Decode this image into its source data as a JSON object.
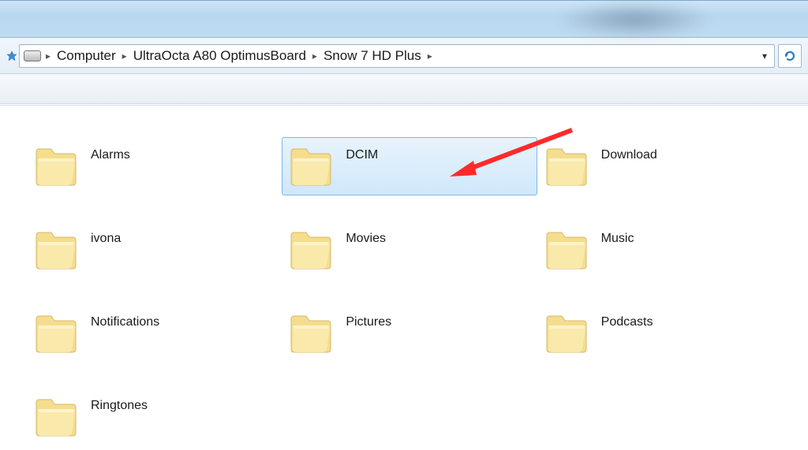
{
  "breadcrumb": {
    "items": [
      "Computer",
      "UltraOcta A80 OptimusBoard",
      "Snow 7 HD Plus"
    ]
  },
  "folders": [
    {
      "name": "Alarms",
      "selected": false
    },
    {
      "name": "DCIM",
      "selected": true
    },
    {
      "name": "Download",
      "selected": false
    },
    {
      "name": "ivona",
      "selected": false
    },
    {
      "name": "Movies",
      "selected": false
    },
    {
      "name": "Music",
      "selected": false
    },
    {
      "name": "Notifications",
      "selected": false
    },
    {
      "name": "Pictures",
      "selected": false
    },
    {
      "name": "Podcasts",
      "selected": false
    },
    {
      "name": "Ringtones",
      "selected": false
    }
  ]
}
